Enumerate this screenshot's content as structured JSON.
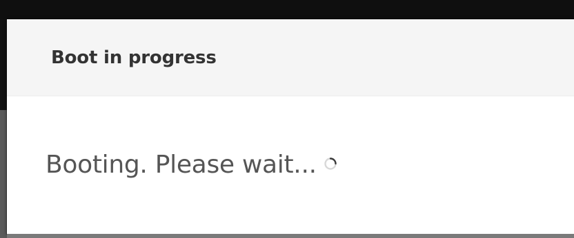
{
  "dialog": {
    "title": "Boot in progress",
    "status_text": "Booting. Please wait...",
    "spinner_icon": "loading-spinner-icon"
  },
  "colors": {
    "header_background": "#f5f5f5",
    "body_background": "#ffffff",
    "title_color": "#333333",
    "text_color": "#555555",
    "backdrop_dark": "#121212",
    "backdrop_gray": "#5b5b5b"
  }
}
